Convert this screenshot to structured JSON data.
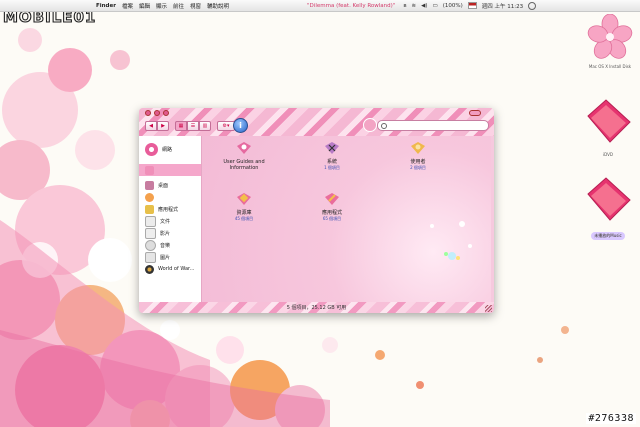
{
  "menubar": {
    "apple_icon": "apple-icon",
    "menus": [
      "Finder",
      "檔案",
      "編輯",
      "顯示",
      "前往",
      "視窗",
      "輔助說明"
    ],
    "now_playing": "\"Dilemma (feat. Kelly Rowland)\"",
    "battery": "(100%)",
    "clock": "週四 上午 11:23"
  },
  "watermark": "#276338",
  "logo_text": "MOBILE01",
  "desktop": {
    "icons": [
      {
        "label": "Mac OS X Install Disk",
        "icon": "sakura-drive-icon"
      },
      {
        "label": "iDVD",
        "icon": "pink-folder-icon"
      },
      {
        "label": "未播放的Music",
        "icon": "pink-folder-icon"
      }
    ]
  },
  "window": {
    "toolbar": {
      "back": "◀",
      "forward": "▶",
      "views": [
        "icon-view",
        "list-view",
        "column-view"
      ],
      "action": "⚙▾",
      "info": "i",
      "search_placeholder": ""
    },
    "sidebar": [
      {
        "label": "網路",
        "icon": "network-icon",
        "color": "#e85d9a"
      },
      {
        "label": "",
        "icon": "disk-icon",
        "color": "#f08fb9"
      },
      {
        "label": "桌面",
        "icon": "desktop-icon",
        "color": "#c77ca0"
      },
      {
        "label": "",
        "icon": "home-icon",
        "color": "#f4a14d"
      },
      {
        "label": "應用程式",
        "icon": "applications-icon",
        "color": "#e7c04a"
      },
      {
        "label": "文件",
        "icon": "documents-icon",
        "color": "#e6e6e6"
      },
      {
        "label": "影片",
        "icon": "movies-icon",
        "color": "#eeeeee"
      },
      {
        "label": "音樂",
        "icon": "music-icon",
        "color": "#dddddd"
      },
      {
        "label": "圖片",
        "icon": "pictures-icon",
        "color": "#e5e5e5"
      },
      {
        "label": "World of War...",
        "icon": "wow-icon",
        "color": "#333333"
      }
    ],
    "items": [
      {
        "name": "User Guides and Information",
        "sub": "",
        "icon": "user-guides-icon"
      },
      {
        "name": "系統",
        "sub": "1 個項目",
        "icon": "system-icon"
      },
      {
        "name": "使用者",
        "sub": "2 個項目",
        "icon": "users-icon"
      },
      {
        "name": "資源庫",
        "sub": "45 個項目",
        "icon": "library-icon"
      },
      {
        "name": "應用程式",
        "sub": "65 個項目",
        "icon": "applications-folder-icon"
      }
    ],
    "status": "5 個項目，25.12 GB 可用"
  }
}
